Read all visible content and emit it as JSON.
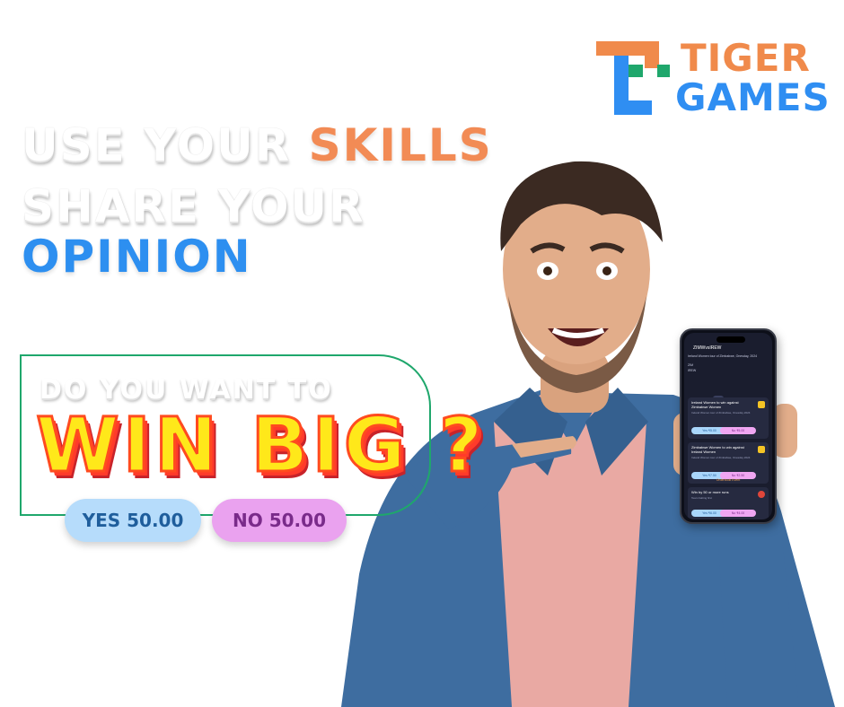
{
  "brand": {
    "line1": "TIGER",
    "line2": "GAMES",
    "colors": {
      "orange": "#f08a4b",
      "blue": "#2f8ef2",
      "green": "#1fa76c"
    }
  },
  "headline": {
    "line1_a": "USE YOUR ",
    "line1_b": "SKILLS",
    "line2": "SHARE YOUR",
    "line3": "OPINION"
  },
  "callout": {
    "subtitle": "DO YOU WANT TO",
    "title": "WIN BIG ?",
    "yes_label": "YES 50.00",
    "no_label": "NO 50.00"
  },
  "phone": {
    "header": "ZIMWvsIREW",
    "match_line": "Ireland Women tour of Zimbabwe, Onesday, 2024",
    "score_zim": "ZIM",
    "score_ire": "IREW",
    "tabs": [
      "All",
      "Runs",
      "Win",
      "Boundaries",
      "Wickets"
    ],
    "cards": [
      {
        "title": "Ireland Women to win against Zimbabwe Women",
        "subtitle": "Ireland Women tour of Zimbabwe, Onesday 2024",
        "yes": "Yes ₹5.00",
        "no": "No ₹5.00"
      },
      {
        "title": "Zimbabwe Women to win against Ireland Women",
        "subtitle": "Ireland Women tour of Zimbabwe, Onesday 2024",
        "yes": "Yes ₹7.50",
        "no": "No ₹2.50"
      },
      {
        "title": "Win by 50 or more runs",
        "subtitle": "Team batting first",
        "yes": "Yes ₹6.00",
        "no": "No ₹4.00"
      }
    ],
    "orderbook": "Orderbook Event"
  }
}
